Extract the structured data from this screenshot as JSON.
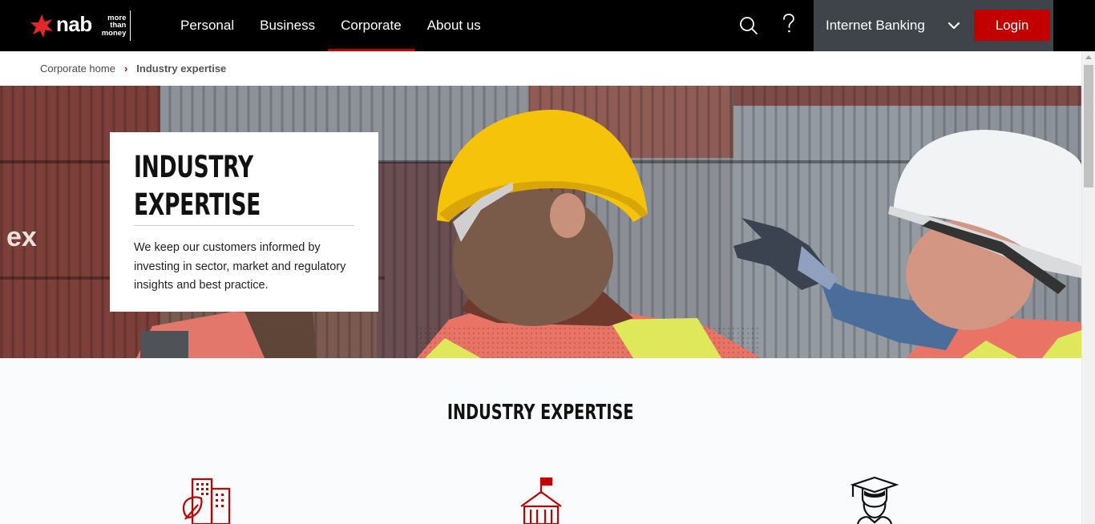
{
  "header": {
    "logo_text": "nab",
    "logo_tagline": [
      "more",
      "than",
      "money"
    ],
    "nav": [
      {
        "label": "Personal"
      },
      {
        "label": "Business"
      },
      {
        "label": "Corporate",
        "active": true
      },
      {
        "label": "About us"
      }
    ],
    "internet_banking_label": "Internet Banking",
    "login_label": "Login",
    "icons": [
      "search-icon",
      "help-icon",
      "chevron-down-icon"
    ]
  },
  "breadcrumb": {
    "home": "Corporate home",
    "current": "Industry expertise"
  },
  "hero": {
    "title_line1": "INDUSTRY",
    "title_line2": "EXPERTISE",
    "body": "We keep our customers informed by investing in sector, market and regulatory insights and best practice."
  },
  "section": {
    "title": "INDUSTRY EXPERTISE",
    "icons": [
      "sustainable-building-icon",
      "government-building-icon",
      "graduate-icon"
    ]
  },
  "colors": {
    "brand_red": "#c20000",
    "nav_black": "#000000",
    "internet_banking_panel": "#3e4449"
  }
}
